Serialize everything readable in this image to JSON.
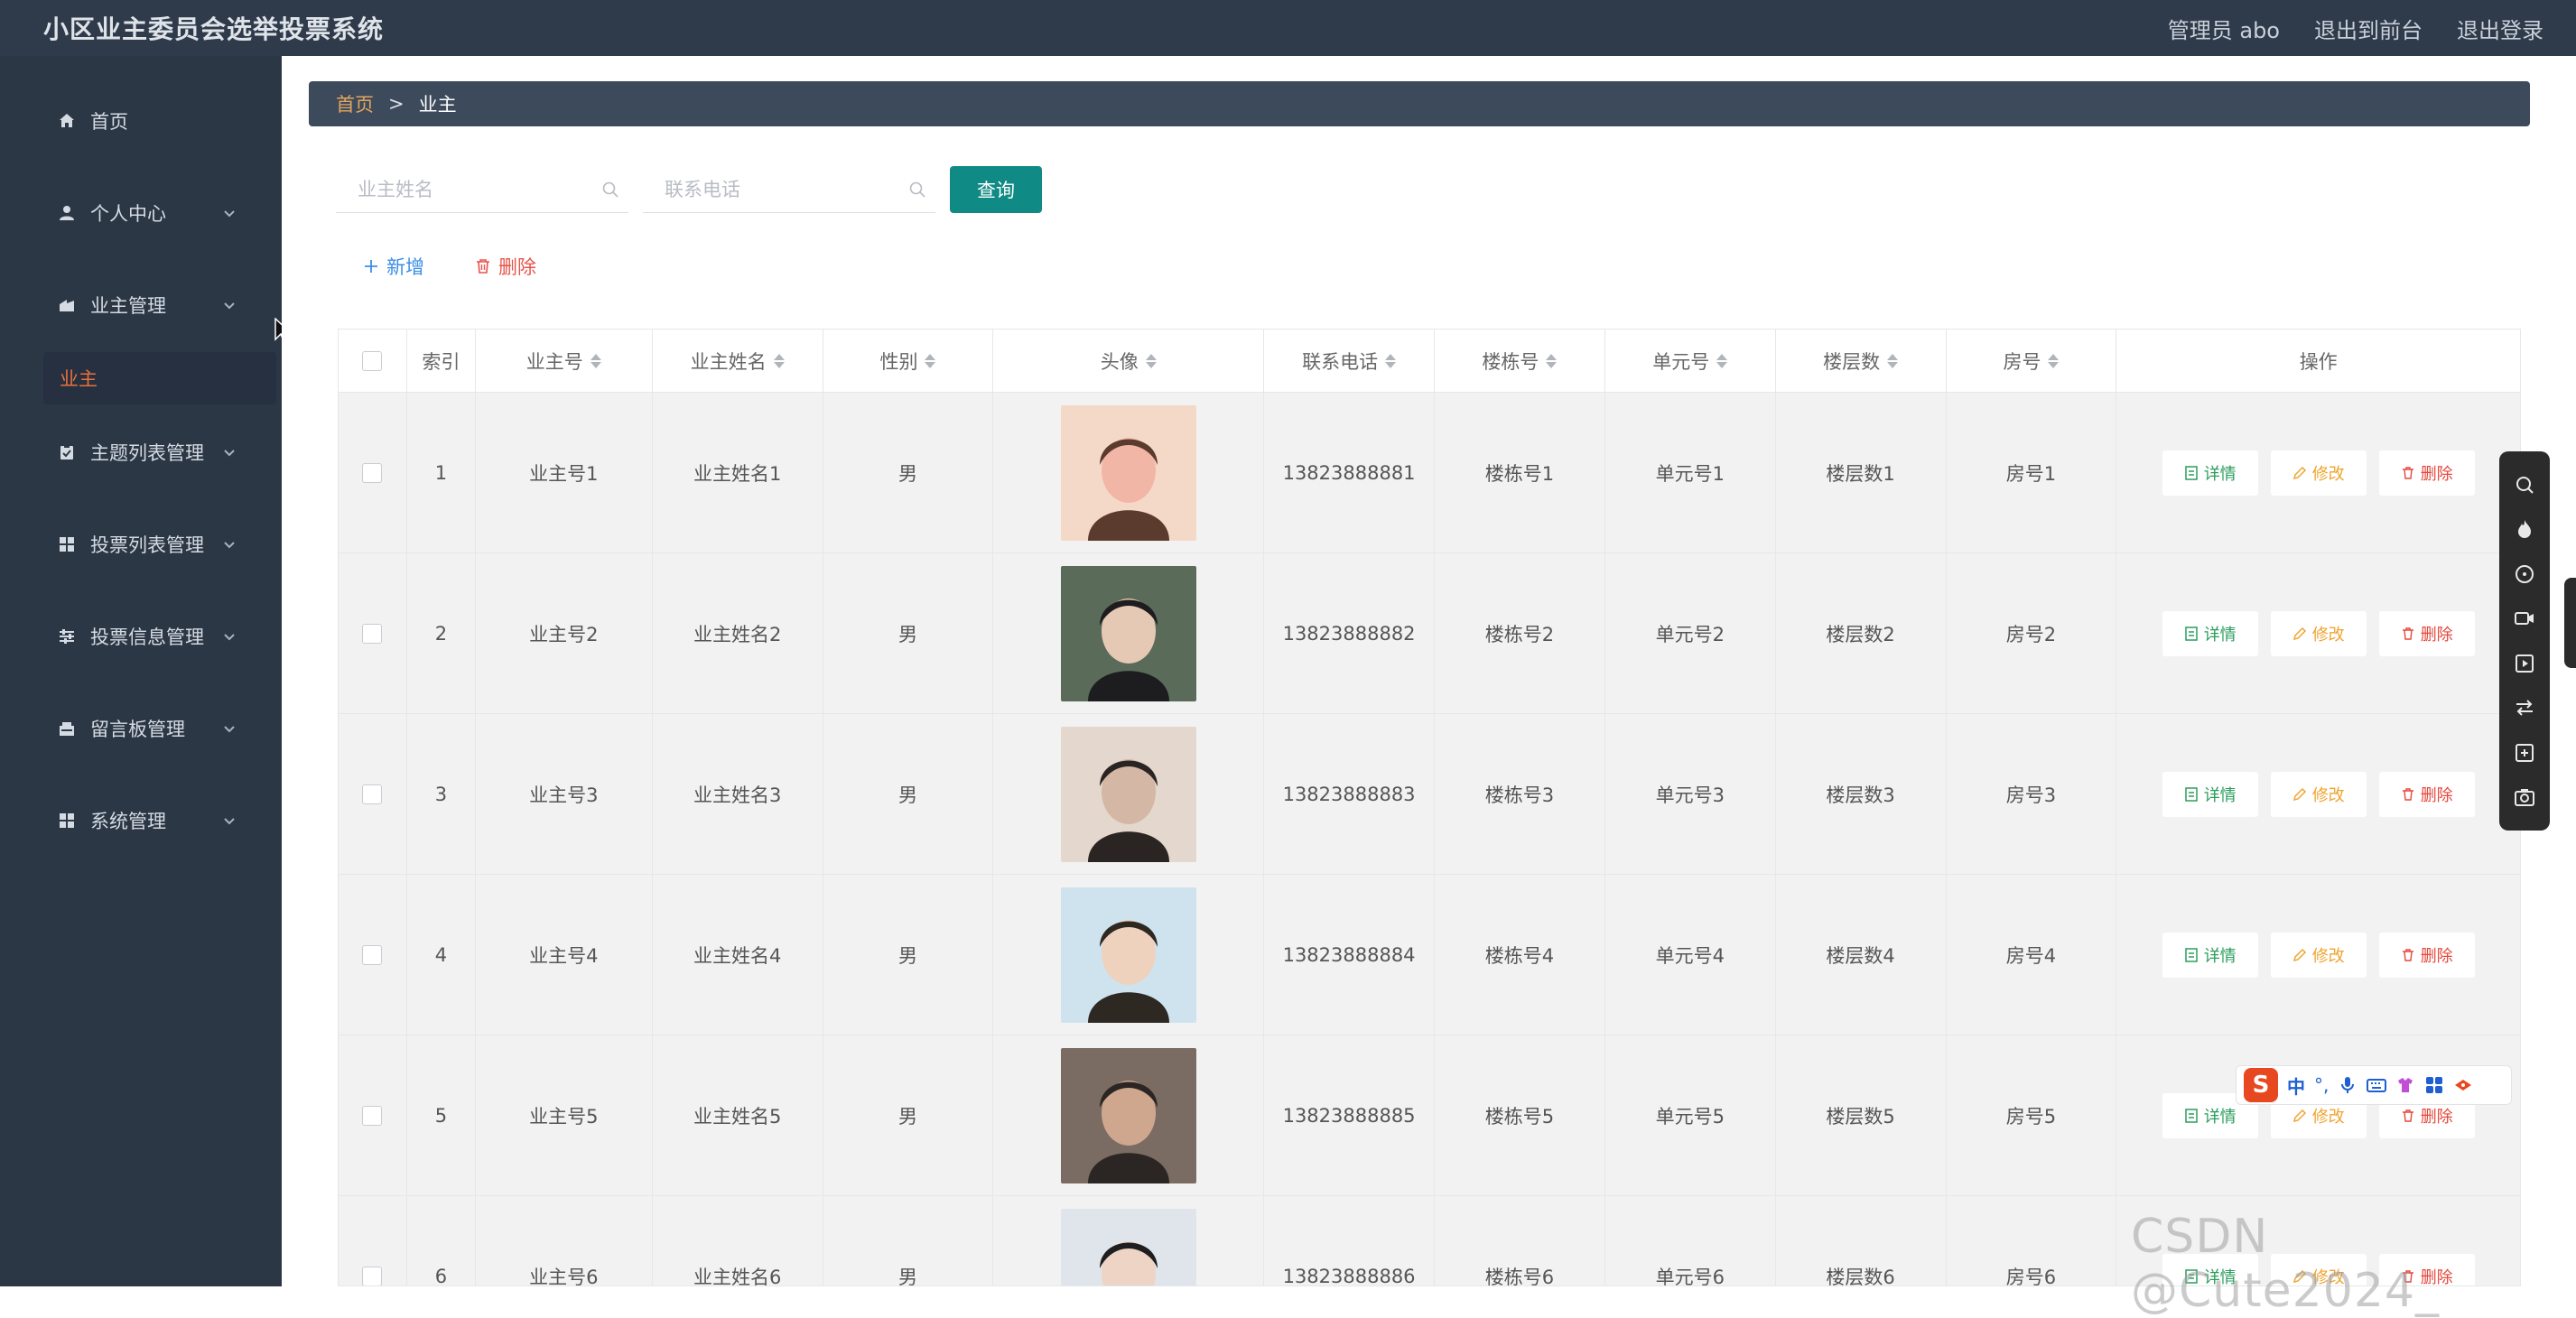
{
  "app": {
    "title": "小区业主委员会选举投票系统",
    "admin_label": "管理员 abo",
    "back_label": "退出到前台",
    "logout_label": "退出登录"
  },
  "sidebar": {
    "items": [
      {
        "label": "首页",
        "icon": "home-icon",
        "expandable": false
      },
      {
        "label": "个人中心",
        "icon": "user-icon",
        "expandable": true
      },
      {
        "label": "业主管理",
        "icon": "owner-icon",
        "expandable": true
      },
      {
        "label": "主题列表管理",
        "icon": "clipboard-icon",
        "expandable": true
      },
      {
        "label": "投票列表管理",
        "icon": "grid-icon",
        "expandable": true
      },
      {
        "label": "投票信息管理",
        "icon": "sliders-icon",
        "expandable": true
      },
      {
        "label": "留言板管理",
        "icon": "message-box-icon",
        "expandable": true
      },
      {
        "label": "系统管理",
        "icon": "grid-icon",
        "expandable": true
      }
    ],
    "active_sub": "业主"
  },
  "breadcrumb": {
    "home": "首页",
    "separator": ">",
    "current": "业主"
  },
  "search": {
    "name_placeholder": "业主姓名",
    "name_value": "",
    "phone_placeholder": "联系电话",
    "phone_value": "",
    "query_label": "查询"
  },
  "actions": {
    "add_label": "新增",
    "delete_label": "删除"
  },
  "table": {
    "headers": {
      "index": "索引",
      "owner_no": "业主号",
      "owner_name": "业主姓名",
      "gender": "性别",
      "avatar": "头像",
      "phone": "联系电话",
      "building": "楼栋号",
      "unit": "单元号",
      "floors": "楼层数",
      "room": "房号",
      "operation": "操作"
    },
    "op_labels": {
      "detail": "详情",
      "edit": "修改",
      "delete": "删除"
    },
    "rows": [
      {
        "index": "1",
        "owner_no": "业主号1",
        "owner_name": "业主姓名1",
        "gender": "男",
        "phone": "13823888881",
        "building": "楼栋号1",
        "unit": "单元号1",
        "floors": "楼层数1",
        "room": "房号1"
      },
      {
        "index": "2",
        "owner_no": "业主号2",
        "owner_name": "业主姓名2",
        "gender": "男",
        "phone": "13823888882",
        "building": "楼栋号2",
        "unit": "单元号2",
        "floors": "楼层数2",
        "room": "房号2"
      },
      {
        "index": "3",
        "owner_no": "业主号3",
        "owner_name": "业主姓名3",
        "gender": "男",
        "phone": "13823888883",
        "building": "楼栋号3",
        "unit": "单元号3",
        "floors": "楼层数3",
        "room": "房号3"
      },
      {
        "index": "4",
        "owner_no": "业主号4",
        "owner_name": "业主姓名4",
        "gender": "男",
        "phone": "13823888884",
        "building": "楼栋号4",
        "unit": "单元号4",
        "floors": "楼层数4",
        "room": "房号4"
      },
      {
        "index": "5",
        "owner_no": "业主号5",
        "owner_name": "业主姓名5",
        "gender": "男",
        "phone": "13823888885",
        "building": "楼栋号5",
        "unit": "单元号5",
        "floors": "楼层数5",
        "room": "房号5"
      },
      {
        "index": "6",
        "owner_no": "业主号6",
        "owner_name": "业主姓名6",
        "gender": "男",
        "phone": "13823888886",
        "building": "楼栋号6",
        "unit": "单元号6",
        "floors": "楼层数6",
        "room": "房号6"
      }
    ]
  },
  "ime": {
    "logo": "S",
    "lang": "中"
  },
  "watermark": "CSDN @Cute2024_",
  "colors": {
    "topbar": "#2f3a4a",
    "sidebar": "#2c3746",
    "accent_teal": "#0f8a84",
    "active_orange": "#e8723a",
    "breadcrumb_bg": "#3d4a5c"
  }
}
